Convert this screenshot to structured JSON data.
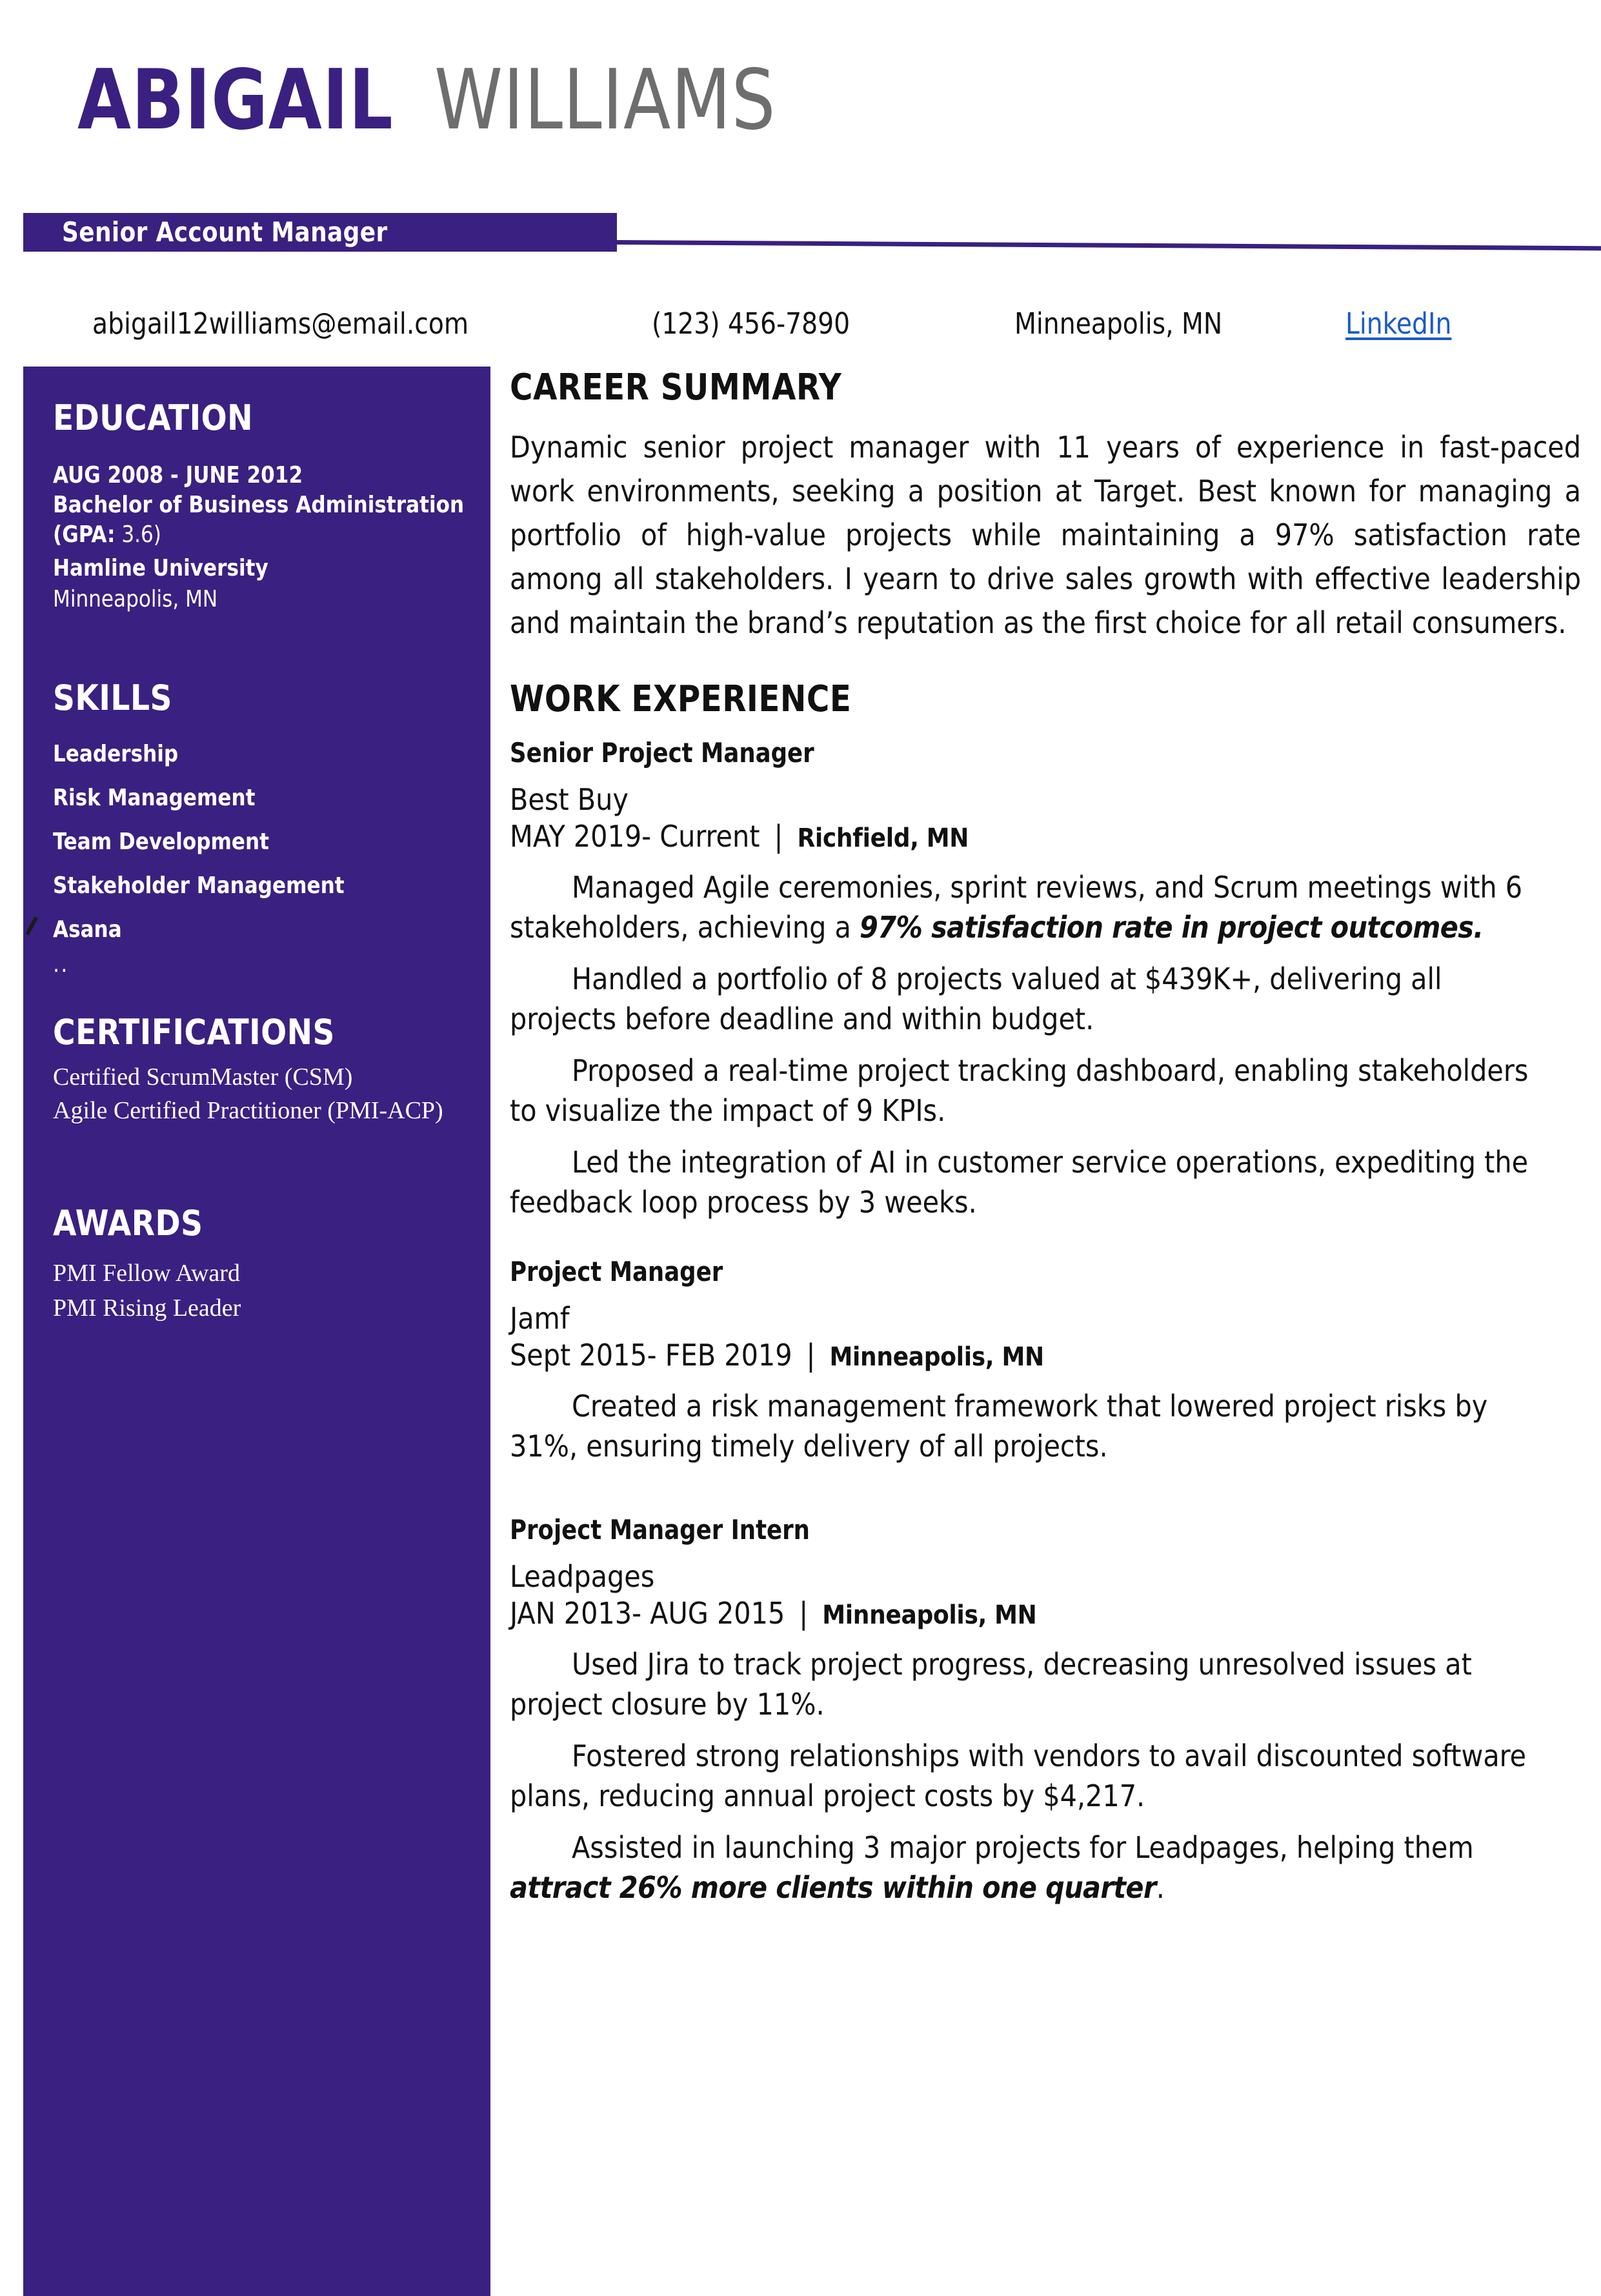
{
  "header": {
    "first_name": "ABIGAIL",
    "last_name": "WILLIAMS",
    "job_title": "Senior Account Manager",
    "colors": {
      "accent_purple": "#3A2080",
      "last_name_gray": "#6E6E6E",
      "link_blue": "#1A5BC4"
    }
  },
  "contact": {
    "email": "abigail12williams@email.com",
    "phone": "(123) 456-7890",
    "location": "Minneapolis, MN",
    "linkedin_label": "LinkedIn"
  },
  "sidebar": {
    "education": {
      "heading": "EDUCATION",
      "dates": "AUG 2008 - JUNE 2012",
      "degree": "Bachelor of Business Administration",
      "gpa_label": "(GPA:",
      "gpa_value": " 3.6)",
      "school": "Hamline University",
      "location": "Minneapolis, MN"
    },
    "skills": {
      "heading": "SKILLS",
      "items": [
        "Leadership",
        "Risk Management",
        "Team Development",
        "Stakeholder Management",
        "Asana"
      ],
      "artifact_dots": ".."
    },
    "certifications": {
      "heading": "CERTIFICATIONS",
      "items": [
        "Certified ScrumMaster (CSM)",
        "Agile Certified Practitioner (PMI-ACP)"
      ]
    },
    "awards": {
      "heading": "AWARDS",
      "items": [
        "PMI Fellow Award",
        "PMI Rising Leader"
      ]
    }
  },
  "main": {
    "summary_heading": "CAREER SUMMARY",
    "summary_text": "Dynamic senior project manager with 11 years of experience in fast-paced work environments, seeking a position at Target. Best known for managing a portfolio of high-value projects while maintaining a 97% satisfaction rate among all stakeholders. I yearn to drive sales growth with effective leadership and maintain the brand’s reputation as the first choice for all retail consumers.",
    "experience_heading": "WORK EXPERIENCE",
    "jobs": [
      {
        "title": "Senior Project Manager",
        "company": "Best Buy",
        "dates": "MAY 2019- Current",
        "separator": "|",
        "location": "Richfield, MN",
        "bullets": [
          {
            "pre": "Managed Agile ceremonies, sprint reviews, and Scrum meetings with 6 stakeholders, achieving a ",
            "emph": "97% satisfaction rate in project outcomes.",
            "post": ""
          },
          {
            "pre": "Handled a portfolio of 8 projects valued at $439K+, delivering all projects before deadline and within budget.",
            "emph": "",
            "post": ""
          },
          {
            "pre": "Proposed a real-time project tracking dashboard, enabling stakeholders to visualize the impact of 9 KPIs.",
            "emph": "",
            "post": ""
          },
          {
            "pre": "Led the integration of AI in customer service operations, expediting the feedback loop process by 3 weeks.",
            "emph": "",
            "post": ""
          }
        ]
      },
      {
        "title": "Project Manager",
        "company": "Jamf",
        "dates": "Sept 2015- FEB 2019",
        "separator": "|",
        "location": "Minneapolis, MN",
        "bullets": [
          {
            "pre": "Created a risk management framework that lowered project risks by 31%, ensuring timely delivery of all projects.",
            "emph": "",
            "post": ""
          }
        ]
      },
      {
        "title": "Project Manager Intern",
        "company": "Leadpages",
        "dates": "JAN 2013- AUG 2015",
        "separator": "|",
        "location": "Minneapolis, MN",
        "bullets": [
          {
            "pre": "Used Jira to track project progress, decreasing unresolved issues at project closure by 11%.",
            "emph": "",
            "post": ""
          },
          {
            "pre": "Fostered strong relationships with vendors to avail discounted software plans, reducing annual project costs by $4,217.",
            "emph": "",
            "post": ""
          },
          {
            "pre": "Assisted in launching 3 major projects for Leadpages, helping them ",
            "emph": "attract 26% more clients within one quarter",
            "post": "."
          }
        ]
      }
    ]
  }
}
